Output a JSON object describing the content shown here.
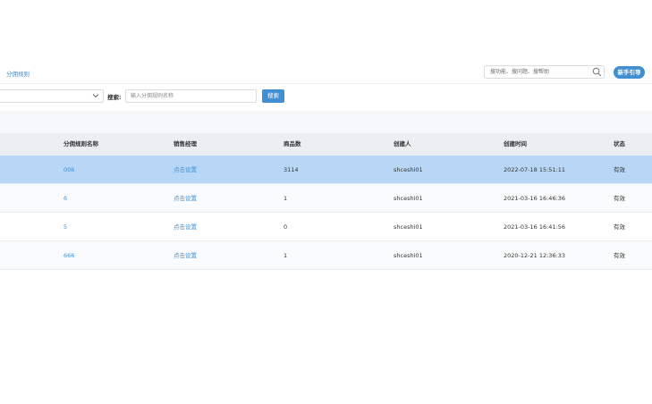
{
  "header": {
    "breadcrumb": "分佣规则",
    "help_search": {
      "placeholder": "搜功能、搜问题、搜帮助"
    },
    "guide_button": "新手引导"
  },
  "filters": {
    "select_value": "",
    "search_label": "搜索:",
    "search_placeholder": "输入分佣规则名称",
    "search_button": "搜索"
  },
  "table": {
    "columns": [
      "分佣规则名称",
      "销售经理",
      "商品数",
      "创建人",
      "创建时间",
      "状态"
    ],
    "rows": [
      {
        "name": "006",
        "manager": "点击设置",
        "count": "3114",
        "creator": "shceshi01",
        "created": "2022-07-18 15:51:11",
        "status": "有效"
      },
      {
        "name": "6",
        "manager": "点击设置",
        "count": "1",
        "creator": "shceshi01",
        "created": "2021-03-16 16:46:36",
        "status": "有效"
      },
      {
        "name": "5",
        "manager": "点击设置",
        "count": "0",
        "creator": "shceshi01",
        "created": "2021-03-16 16:41:56",
        "status": "有效"
      },
      {
        "name": "666",
        "manager": "点击设置",
        "count": "1",
        "creator": "shceshi01",
        "created": "2020-12-21 12:36:33",
        "status": "有效"
      }
    ]
  },
  "colors": {
    "accent": "#3f8fd2",
    "selected_row": "#b8d7f7",
    "header_bg": "#eceef1"
  }
}
